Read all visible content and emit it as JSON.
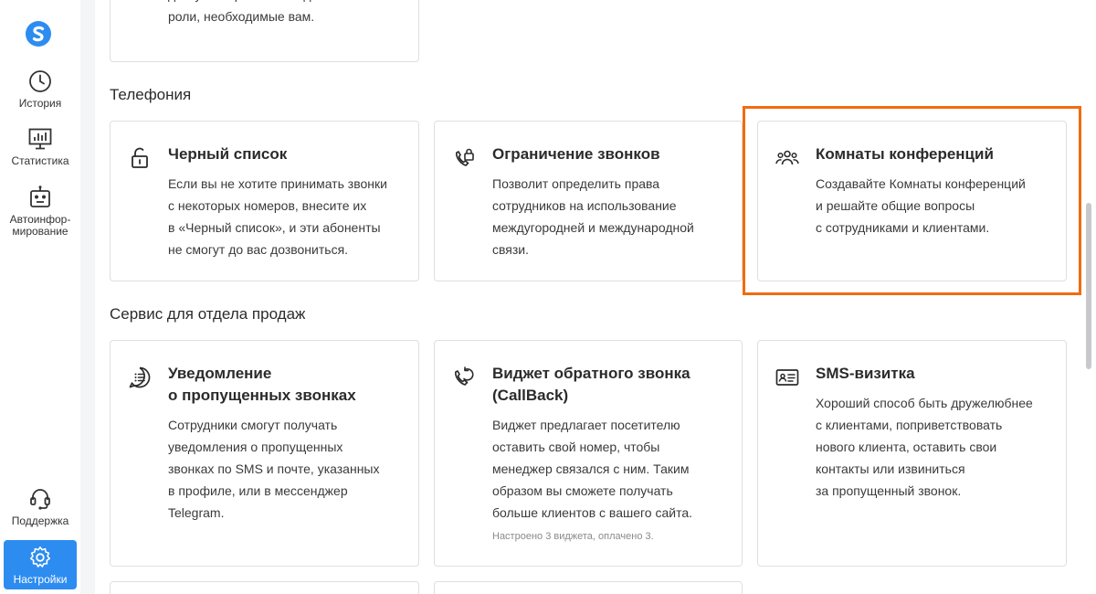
{
  "sidebar": {
    "items": [
      {
        "label": "История",
        "icon": "clock-icon"
      },
      {
        "label": "Статистика",
        "icon": "chart-icon"
      },
      {
        "label": "Автоинфор-\nмирование",
        "icon": "robot-icon"
      },
      {
        "label": "Поддержка",
        "icon": "headset-icon"
      },
      {
        "label": "Настройки",
        "icon": "gear-icon",
        "active": true
      }
    ]
  },
  "top_card": {
    "text": "доступных ролей и создать новые\nроли, необходимые вам."
  },
  "sections": [
    {
      "title": "Телефония",
      "cards": [
        {
          "title": "Черный список",
          "desc": "Если вы не хотите принимать звонки\nс некоторых номеров, внесите их\nв «Черный список», и эти абоненты\nне смогут до вас дозвониться.",
          "icon": "lock-icon"
        },
        {
          "title": "Ограничение звонков",
          "desc": "Позволит определить права\nсотрудников на использование\nмеждугородней и международной\nсвязи.",
          "icon": "phone-lock-icon"
        },
        {
          "title": "Комнаты конференций",
          "desc": "Создавайте Комнаты конференций\nи решайте общие вопросы\nс сотрудниками и клиентами.",
          "icon": "people-icon"
        }
      ]
    },
    {
      "title": "Сервис для отдела продаж",
      "cards": [
        {
          "title": "Уведомление\nо пропущенных звонках",
          "desc": "Сотрудники смогут получать\nуведомления о пропущенных\nзвонках по SMS и почте, указанных\nв профиле, или в мессенджер\nTelegram.",
          "icon": "chat-list-icon"
        },
        {
          "title": "Виджет обратного звонка\n(CallBack)",
          "desc": "Виджет предлагает посетителю\nоставить свой номер, чтобы\nменеджер связался с ним. Таким\nобразом вы сможете получать\nбольше клиентов с вашего сайта.",
          "note": "Настроено 3 виджета, оплачено 3.",
          "icon": "callback-icon"
        },
        {
          "title": "SMS-визитка",
          "desc": "Хороший способ быть дружелюбнее\nс клиентами, поприветствовать\nнового клиента, оставить свои\nконтакты или извиниться\nза пропущенный звонок.",
          "icon": "id-card-icon"
        }
      ]
    }
  ],
  "colors": {
    "accent": "#2d8cf0",
    "highlight": "#f26b0f"
  }
}
